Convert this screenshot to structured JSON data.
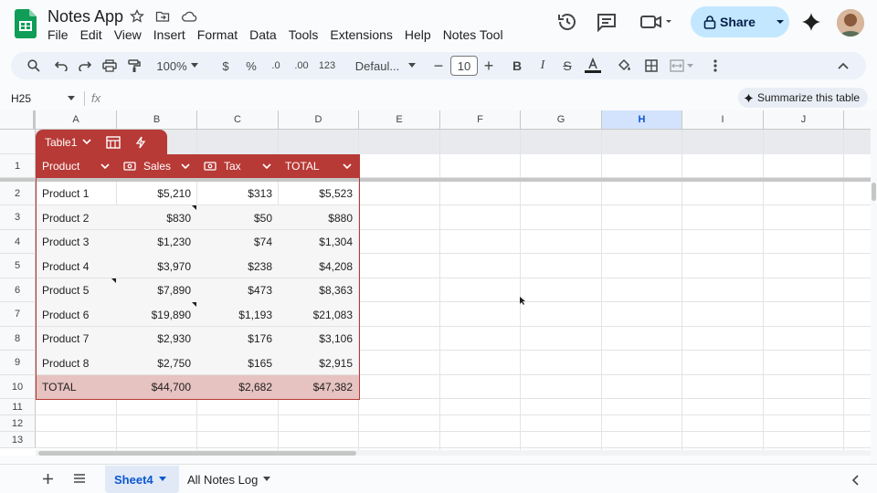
{
  "app": {
    "title": "Notes App"
  },
  "menu": [
    "File",
    "Edit",
    "View",
    "Insert",
    "Format",
    "Data",
    "Tools",
    "Extensions",
    "Help",
    "Notes Tool"
  ],
  "header": {
    "share_label": "Share"
  },
  "toolbar": {
    "zoom": "100%",
    "currency": "$",
    "percent": "%",
    "dec_minus": ".0",
    "dec_plus": ".00",
    "format_123": "123",
    "font": "Defaul...",
    "font_size": "10"
  },
  "formula": {
    "cell_ref": "H25",
    "fx": "fx",
    "summarize_label": "Summarize this table"
  },
  "columns": [
    "A",
    "B",
    "C",
    "D",
    "E",
    "F",
    "G",
    "H",
    "I",
    "J"
  ],
  "selected_column": "H",
  "rows": [
    "1",
    "2",
    "3",
    "4",
    "5",
    "6",
    "7",
    "8",
    "9",
    "10",
    "11",
    "12",
    "13"
  ],
  "table": {
    "name": "Table1",
    "headers": [
      "Product",
      "Sales",
      "Tax",
      "TOTAL"
    ],
    "data": [
      [
        "Product 1",
        "$5,210",
        "$313",
        "$5,523"
      ],
      [
        "Product 2",
        "$830",
        "$50",
        "$880"
      ],
      [
        "Product 3",
        "$1,230",
        "$74",
        "$1,304"
      ],
      [
        "Product 4",
        "$3,970",
        "$238",
        "$4,208"
      ],
      [
        "Product 5",
        "$7,890",
        "$473",
        "$8,363"
      ],
      [
        "Product 6",
        "$19,890",
        "$1,193",
        "$21,083"
      ],
      [
        "Product 7",
        "$2,930",
        "$176",
        "$3,106"
      ],
      [
        "Product 8",
        "$2,750",
        "$165",
        "$2,915"
      ]
    ],
    "total": [
      "TOTAL",
      "$44,700",
      "$2,682",
      "$47,382"
    ],
    "header_color": "#b73a36",
    "total_color": "#e6c2c0"
  },
  "sheets": {
    "active": "Sheet4",
    "other": "All Notes Log"
  }
}
